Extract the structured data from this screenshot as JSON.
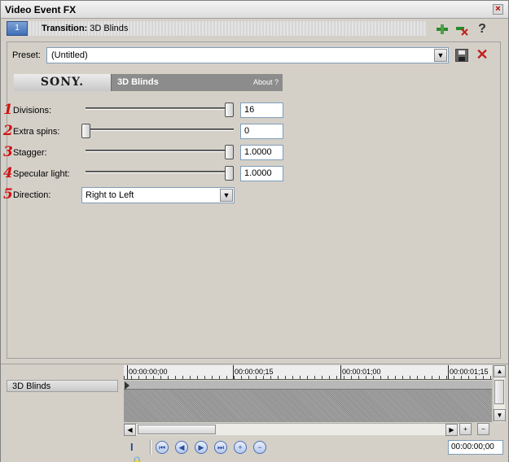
{
  "window": {
    "title": "Video Event FX",
    "close_glyph": "×"
  },
  "header": {
    "slot_number": "1",
    "transition_prefix": "Transition:",
    "transition_name": "3D Blinds",
    "icons": [
      "plug-in-icon",
      "remove-plug-in-icon",
      "help-icon"
    ],
    "help_glyph": "?"
  },
  "preset": {
    "label": "Preset:",
    "value": "(Untitled)"
  },
  "plugin": {
    "brand": "SONY.",
    "name": "3D Blinds",
    "about": "About  ?"
  },
  "params": [
    {
      "num": "1",
      "label": "Divisions:",
      "value": "16",
      "slider_fraction": 1.0
    },
    {
      "num": "2",
      "label": "Extra spins:",
      "value": "0",
      "slider_fraction": 0.0
    },
    {
      "num": "3",
      "label": "Stagger:",
      "value": "1.0000",
      "slider_fraction": 1.0
    },
    {
      "num": "4",
      "label": "Specular light:",
      "value": "1.0000",
      "slider_fraction": 1.0
    }
  ],
  "direction": {
    "num": "5",
    "label": "Direction:",
    "value": "Right to Left"
  },
  "timeline": {
    "track_label": "3D Blinds",
    "ruler": [
      "00:00:00;00",
      "00:00:00;15",
      "00:00:01;00",
      "00:00:01;15"
    ],
    "current_time": "00:00:00;00"
  },
  "colors": {
    "accent": "#d21010",
    "plugin_bar": "#8c8c8c",
    "slot": "#3f6fb8"
  }
}
